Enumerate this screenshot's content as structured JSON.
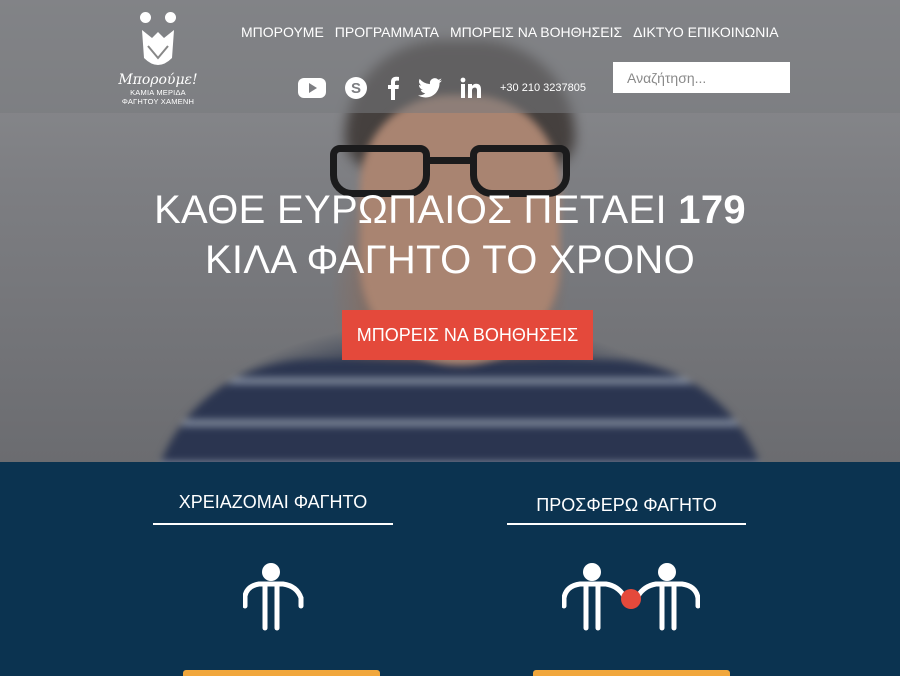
{
  "logo": {
    "script_text": "Μπορούμε!",
    "tagline_line1": "ΚΑΜΙΑ ΜΕΡΙΔΑ",
    "tagline_line2": "ΦΑΓΗΤΟΥ ΧΑΜΕΝΗ"
  },
  "nav": {
    "items": [
      {
        "label": "ΜΠΟΡΟΥΜΕ"
      },
      {
        "label": "ΠΡΟΓΡΑΜΜΑΤΑ"
      },
      {
        "label": "ΜΠΟΡΕΙΣ ΝΑ ΒΟΗΘΗΣΕΙΣ"
      },
      {
        "label": "ΔΙΚΤΥΟ ΕΠΙΚΟΙΝΩΝΙΑ"
      }
    ]
  },
  "social": {
    "icons": [
      "youtube-icon",
      "skype-icon",
      "facebook-icon",
      "twitter-icon",
      "linkedin-icon"
    ],
    "phone": "+30 210 3237805"
  },
  "search": {
    "placeholder": "Αναζήτηση..."
  },
  "hero": {
    "headline_line1_prefix": "ΚΑΘΕ ΕΥΡΩΠΑΙΟΣ ΠΕΤΑΕΙ",
    "headline_number": "179",
    "headline_line2": "ΚΙΛΑ ΦΑΓΗΤΟ ΤΟ ΧΡΟΝΟ",
    "cta_label": "ΜΠΟΡΕΙΣ ΝΑ ΒΟΗΘΗΣΕΙΣ"
  },
  "columns": [
    {
      "title": "ΧΡΕΙΑΖΟΜΑΙ ΦΑΓΗΤΟ"
    },
    {
      "title": "ΠΡΟΣΦΕΡΩ ΦΑΓΗΤΟ"
    }
  ],
  "colors": {
    "accent_red": "#e4493b",
    "section_bg": "#0b3350",
    "button_orange": "#f1a73c"
  }
}
